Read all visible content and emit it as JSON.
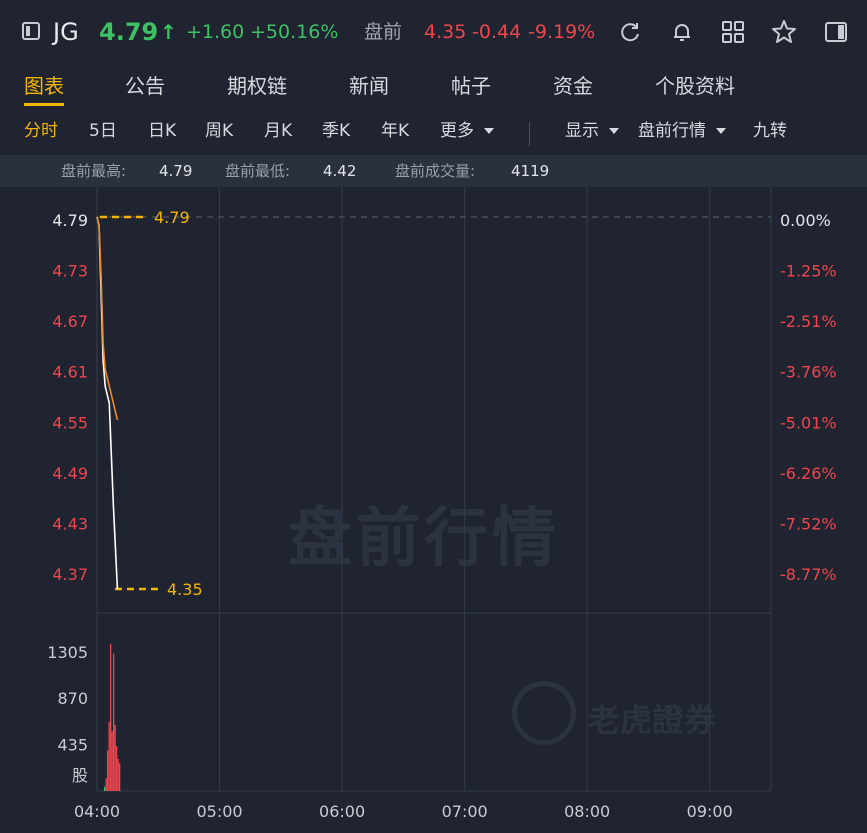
{
  "header": {
    "ticker": "JG",
    "price": "4.79",
    "arrow": "↑",
    "change": "+1.60",
    "change_pct": "+50.16%",
    "premarket_label": "盘前",
    "premarket_price": "4.35",
    "premarket_change": "-0.44",
    "premarket_change_pct": "-9.19%",
    "up_color": "#3ec064",
    "down_color": "#f0454d",
    "icons": [
      "refresh-icon",
      "bell-icon",
      "grid-icon",
      "star-icon",
      "panel-toggle-icon"
    ]
  },
  "tabs": [
    {
      "label": "图表",
      "active": true
    },
    {
      "label": "公告",
      "active": false
    },
    {
      "label": "期权链",
      "active": false
    },
    {
      "label": "新闻",
      "active": false
    },
    {
      "label": "帖子",
      "active": false
    },
    {
      "label": "资金",
      "active": false
    },
    {
      "label": "个股资料",
      "active": false
    }
  ],
  "toolbar": {
    "periods": [
      {
        "label": "分时",
        "active": true
      },
      {
        "label": "5日",
        "active": false
      },
      {
        "label": "日K",
        "active": false
      },
      {
        "label": "周K",
        "active": false
      },
      {
        "label": "月K",
        "active": false
      },
      {
        "label": "季K",
        "active": false
      },
      {
        "label": "年K",
        "active": false
      }
    ],
    "more_label": "更多",
    "display_label": "显示",
    "premarket_quote_label": "盘前行情",
    "nine_turn_label": "九转",
    "accent": "#f4b400"
  },
  "stats": {
    "high_label": "盘前最高:",
    "high_value": "4.79",
    "low_label": "盘前最低:",
    "low_value": "4.42",
    "volume_label": "盘前成交量:",
    "volume_value": "4119"
  },
  "watermarks": {
    "center": "盘前行情",
    "brand": "老虎證券"
  },
  "chart_data": {
    "type": "line",
    "price_axis": {
      "ticks": [
        "4.79",
        "4.73",
        "4.67",
        "4.61",
        "4.55",
        "4.49",
        "4.43",
        "4.37"
      ],
      "ylim": [
        4.35,
        4.79
      ]
    },
    "pct_axis": {
      "ticks": [
        "0.00%",
        "-1.25%",
        "-2.51%",
        "-3.76%",
        "-5.01%",
        "-6.26%",
        "-7.52%",
        "-8.77%"
      ]
    },
    "volume_axis": {
      "ticks": [
        "1305",
        "870",
        "435"
      ],
      "unit": "股",
      "ylim": [
        0,
        1500
      ]
    },
    "x_ticks": [
      "04:00",
      "05:00",
      "06:00",
      "07:00",
      "08:00",
      "09:00"
    ],
    "x_range_minutes": [
      0,
      330
    ],
    "high_marker": "4.79",
    "low_marker": "4.35",
    "series": [
      {
        "color": "#ffffff",
        "x": [
          0,
          1,
          2,
          3,
          4,
          5,
          6,
          8,
          10
        ],
        "values": [
          4.79,
          4.78,
          4.7,
          4.62,
          4.59,
          4.58,
          4.57,
          4.45,
          4.35
        ]
      },
      {
        "color": "#f08a24",
        "x": [
          0,
          1,
          2,
          3,
          4,
          5,
          6,
          8,
          10
        ],
        "values": [
          4.79,
          4.78,
          4.72,
          4.64,
          4.61,
          4.6,
          4.59,
          4.57,
          4.55
        ]
      }
    ],
    "volume": {
      "x": [
        0,
        1,
        2,
        3,
        4,
        5,
        6,
        7,
        8,
        9,
        10
      ],
      "values": [
        40,
        120,
        380,
        650,
        1380,
        560,
        1290,
        620,
        420,
        300,
        260
      ],
      "colors": [
        "#3ec064",
        "#f0454d",
        "#f0454d",
        "#f0454d",
        "#f0454d",
        "#f0454d",
        "#f0454d",
        "#f0454d",
        "#f0454d",
        "#f0454d",
        "#f0454d"
      ]
    },
    "grid": true
  }
}
